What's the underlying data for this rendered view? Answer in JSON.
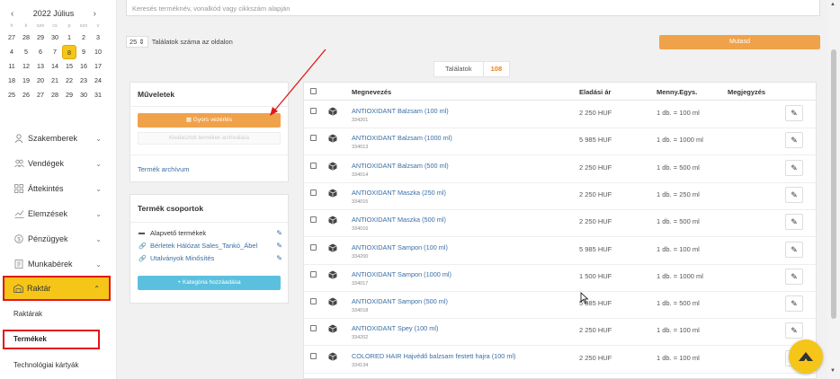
{
  "calendar": {
    "title": "2022 Július",
    "prev": "‹",
    "next": "›",
    "weekdays": [
      "h",
      "k",
      "sze",
      "cs",
      "p",
      "szo",
      "v"
    ],
    "weeks": [
      [
        "27",
        "28",
        "29",
        "30",
        "1",
        "2",
        "3"
      ],
      [
        "4",
        "5",
        "6",
        "7",
        "8",
        "9",
        "10"
      ],
      [
        "11",
        "12",
        "13",
        "14",
        "15",
        "16",
        "17"
      ],
      [
        "18",
        "19",
        "20",
        "21",
        "22",
        "23",
        "24"
      ],
      [
        "25",
        "26",
        "27",
        "28",
        "29",
        "30",
        "31"
      ]
    ],
    "selected": "8"
  },
  "sidebar": {
    "items": [
      {
        "label": "Szakemberek",
        "icon": "person-icon"
      },
      {
        "label": "Vendégek",
        "icon": "people-icon"
      },
      {
        "label": "Áttekintés",
        "icon": "grid-icon"
      },
      {
        "label": "Elemzések",
        "icon": "chart-icon"
      },
      {
        "label": "Pénzügyek",
        "icon": "dollar-icon"
      },
      {
        "label": "Munkabérek",
        "icon": "payroll-icon"
      }
    ],
    "active": {
      "label": "Raktár",
      "icon": "warehouse-icon"
    },
    "sub_items": [
      "Raktárak",
      "Termékek",
      "Technológiai kártyák"
    ]
  },
  "search": {
    "placeholder": "Keresés terméknév, vonalkód vagy cikkszám alapján"
  },
  "pagesize": {
    "value": "25",
    "label": "Találatok száma az oldalon"
  },
  "show_button": "Mutasd",
  "results": {
    "label": "Találatok",
    "count": "108"
  },
  "muveletek": {
    "title": "Műveletek",
    "quick_edit": "Gyors vezérlés",
    "archive_selected": "Kiválasztott termékek archiválása",
    "archive_link": "Termék archívum"
  },
  "groups": {
    "title": "Termék csoportok",
    "items": [
      {
        "label": "Alapvető termékek",
        "icon": "folder-icon"
      },
      {
        "label": "Bérletek Hálózat Sales_Tankó_Ábel",
        "icon": "link-icon"
      },
      {
        "label": "Utalványok Minősítés",
        "icon": "link-icon"
      }
    ],
    "add_button": "+ Kategória hozzáadása"
  },
  "table": {
    "headers": {
      "name": "Megnevezés",
      "price": "Eladási ár",
      "unit": "Menny.Egys.",
      "note": "Megjegyzés"
    },
    "rows": [
      {
        "name": "ANTIOXIDANT Balzsam (100 ml)",
        "sku": "334201",
        "price": "2 250 HUF",
        "unit": "1 db. = 100 ml"
      },
      {
        "name": "ANTIOXIDANT Balzsam (1000 ml)",
        "sku": "334013",
        "price": "5 985 HUF",
        "unit": "1 db. = 1000 ml"
      },
      {
        "name": "ANTIOXIDANT Balzsam (500 ml)",
        "sku": "334014",
        "price": "2 250 HUF",
        "unit": "1 db. = 500 ml"
      },
      {
        "name": "ANTIOXIDANT Maszka (250 ml)",
        "sku": "334015",
        "price": "2 250 HUF",
        "unit": "1 db. = 250 ml"
      },
      {
        "name": "ANTIOXIDANT Maszka (500 ml)",
        "sku": "334016",
        "price": "2 250 HUF",
        "unit": "1 db. = 500 ml"
      },
      {
        "name": "ANTIOXIDANT Sampon (100 ml)",
        "sku": "334200",
        "price": "5 985 HUF",
        "unit": "1 db. = 100 ml"
      },
      {
        "name": "ANTIOXIDANT Sampon (1000 ml)",
        "sku": "334017",
        "price": "1 500 HUF",
        "unit": "1 db. = 1000 ml"
      },
      {
        "name": "ANTIOXIDANT Sampon (500 ml)",
        "sku": "334018",
        "price": "5 985 HUF",
        "unit": "1 db. = 500 ml"
      },
      {
        "name": "ANTIOXIDANT Spey (100 ml)",
        "sku": "334202",
        "price": "2 250 HUF",
        "unit": "1 db. = 100 ml"
      },
      {
        "name": "COLORED HAIR Hajvédő balzsam festett hajra (100 ml)",
        "sku": "334134",
        "price": "2 250 HUF",
        "unit": "1 db. = 100 ml"
      }
    ]
  },
  "colors": {
    "accent": "#f0a24b",
    "highlight": "#f5c518",
    "annotation": "#e01717",
    "link": "#3a6ea5",
    "teal": "#5bc0de"
  }
}
